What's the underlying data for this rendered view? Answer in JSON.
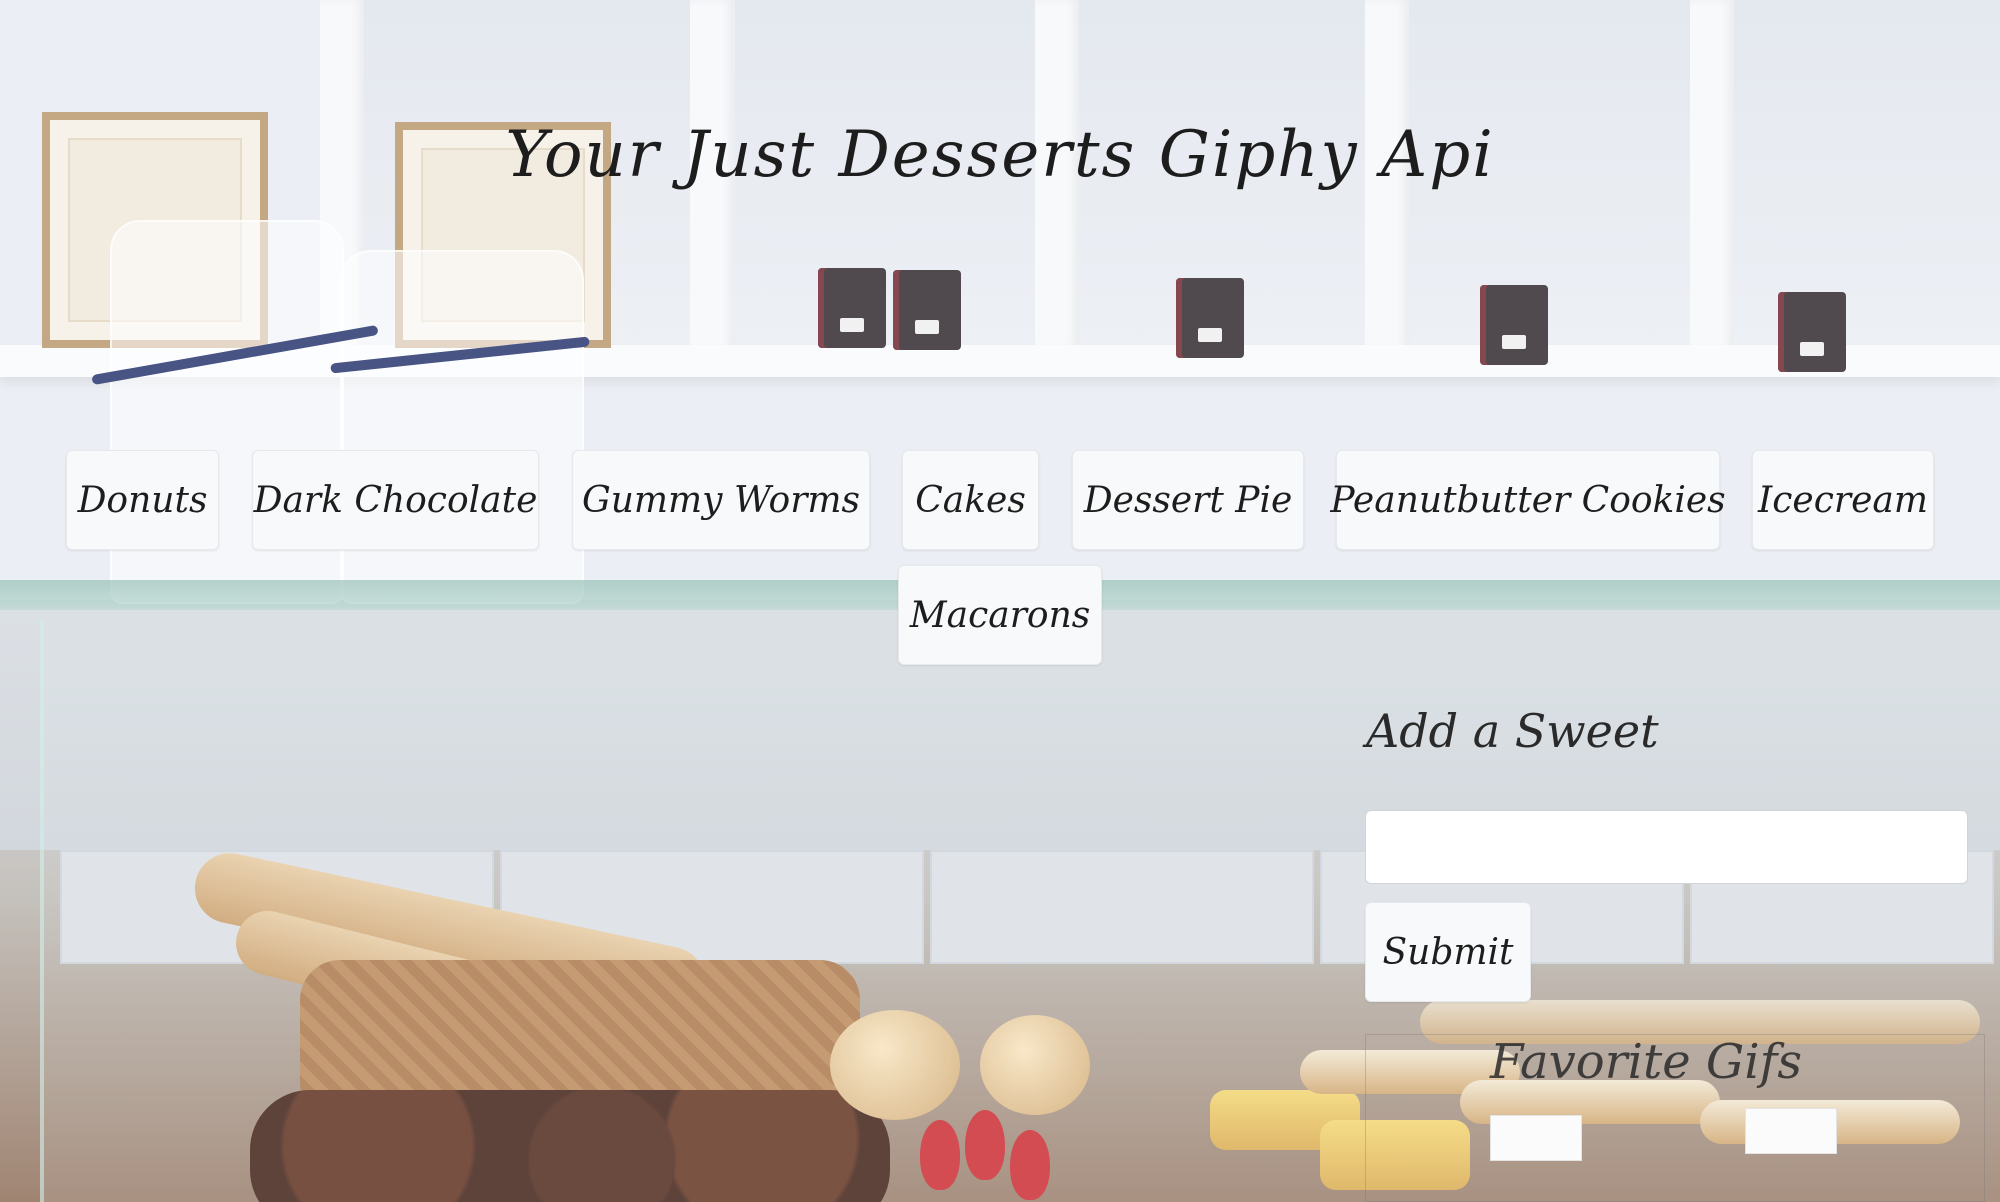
{
  "page": {
    "title": "Your Just Desserts Giphy Api"
  },
  "topics": [
    "Donuts",
    "Dark Chocolate",
    "Gummy Worms",
    "Cakes",
    "Dessert Pie",
    "Peanutbutter Cookies",
    "Icecream",
    "Macarons"
  ],
  "add_form": {
    "heading": "Add a Sweet",
    "input_value": "",
    "input_placeholder": "",
    "submit_label": "Submit"
  },
  "favorites": {
    "heading": "Favorite Gifs"
  },
  "colors": {
    "button_bg": "#f8f9fa",
    "text": "#1d1d1d",
    "ribbon": "#1f2f6a"
  }
}
